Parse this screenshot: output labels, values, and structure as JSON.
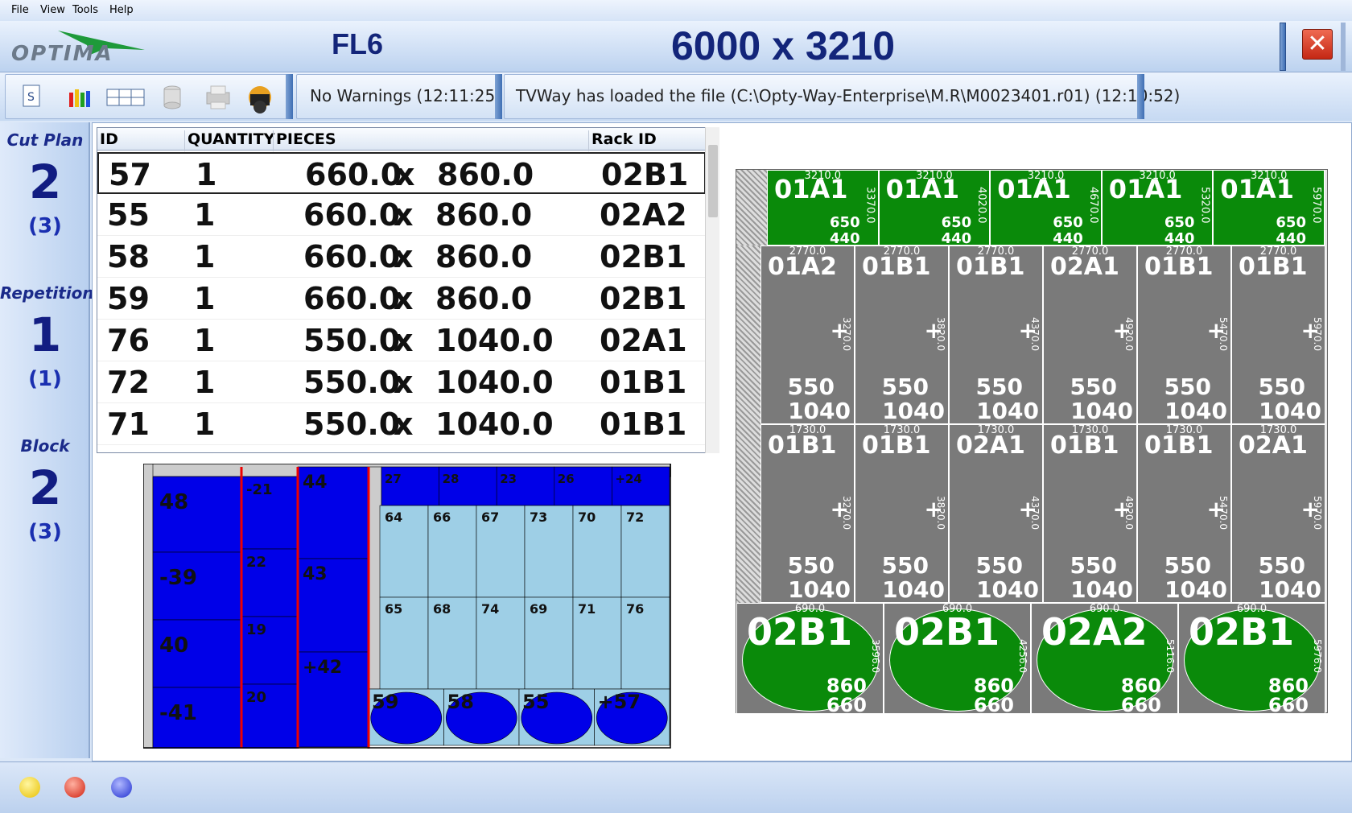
{
  "menu": {
    "file": "File",
    "view": "View",
    "tools": "Tools",
    "help": "Help"
  },
  "header": {
    "logo_text": "OPTIMA",
    "machine": "FL6",
    "dimensions": "6000 x 3210",
    "close": "✕"
  },
  "toolbar": {
    "warnings": "No Warnings (12:11:25)",
    "status": "TVWay has loaded the file (C:\\Opty-Way-Enterprise\\M.R\\M0023401.r01) (12:10:52)"
  },
  "left_panel": {
    "cut_plan_label": "Cut Plan",
    "cut_plan_value": "2",
    "cut_plan_total": "(3)",
    "repetition_label": "Repetition",
    "repetition_value": "1",
    "repetition_total": "(1)",
    "block_label": "Block",
    "block_value": "2",
    "block_total": "(3)"
  },
  "table": {
    "headers": {
      "id": "ID",
      "quantity": "QUANTITY",
      "pieces": "PIECES",
      "rack": "Rack ID"
    },
    "rows": [
      {
        "id": "57",
        "qty": "1",
        "w": "660.0",
        "x": "x",
        "h": "860.0",
        "rack": "02B1"
      },
      {
        "id": "55",
        "qty": "1",
        "w": "660.0",
        "x": "x",
        "h": "860.0",
        "rack": "02A2"
      },
      {
        "id": "58",
        "qty": "1",
        "w": "660.0",
        "x": "x",
        "h": "860.0",
        "rack": "02B1"
      },
      {
        "id": "59",
        "qty": "1",
        "w": "660.0",
        "x": "x",
        "h": "860.0",
        "rack": "02B1"
      },
      {
        "id": "76",
        "qty": "1",
        "w": "550.0",
        "x": "x",
        "h": "1040.0",
        "rack": "02A1"
      },
      {
        "id": "72",
        "qty": "1",
        "w": "550.0",
        "x": "x",
        "h": "1040.0",
        "rack": "01B1"
      },
      {
        "id": "71",
        "qty": "1",
        "w": "550.0",
        "x": "x",
        "h": "1040.0",
        "rack": "01B1"
      }
    ]
  },
  "map": {
    "col1": [
      "48",
      "-39",
      "40",
      "-41"
    ],
    "col2": [
      "-21",
      "22",
      "19",
      "20"
    ],
    "col3": [
      "44",
      "43",
      "+42"
    ],
    "top_strip": [
      "27",
      "28",
      "23",
      "26",
      "+24"
    ],
    "grid_row1": [
      "64",
      "66",
      "67",
      "73",
      "70",
      "72"
    ],
    "grid_row2": [
      "65",
      "68",
      "74",
      "69",
      "71",
      "76"
    ],
    "ovals": [
      "59",
      "58",
      "55",
      "+57"
    ]
  },
  "sheet": {
    "green_top": [
      {
        "rack": "01A1",
        "top": "3210.0",
        "side": "3370.0",
        "w": "650",
        "h": "440"
      },
      {
        "rack": "01A1",
        "top": "3210.0",
        "side": "4020.0",
        "w": "650",
        "h": "440"
      },
      {
        "rack": "01A1",
        "top": "3210.0",
        "side": "4670.0",
        "w": "650",
        "h": "440"
      },
      {
        "rack": "01A1",
        "top": "3210.0",
        "side": "5320.0",
        "w": "650",
        "h": "440"
      },
      {
        "rack": "01A1",
        "top": "3210.0",
        "side": "5970.0",
        "w": "650",
        "h": "440"
      }
    ],
    "gray_row1": [
      {
        "rack": "01A2",
        "top": "2770.0",
        "side": "3270.0",
        "w": "550",
        "h": "1040"
      },
      {
        "rack": "01B1",
        "top": "2770.0",
        "side": "3820.0",
        "w": "550",
        "h": "1040"
      },
      {
        "rack": "01B1",
        "top": "2770.0",
        "side": "4370.0",
        "w": "550",
        "h": "1040"
      },
      {
        "rack": "02A1",
        "top": "2770.0",
        "side": "4920.0",
        "w": "550",
        "h": "1040"
      },
      {
        "rack": "01B1",
        "top": "2770.0",
        "side": "5470.0",
        "w": "550",
        "h": "1040"
      },
      {
        "rack": "01B1",
        "top": "2770.0",
        "side": "5970.0",
        "w": "550",
        "h": "1040"
      }
    ],
    "gray_row2": [
      {
        "rack": "01B1",
        "top": "1730.0",
        "side": "3270.0",
        "w": "550",
        "h": "1040"
      },
      {
        "rack": "01B1",
        "top": "1730.0",
        "side": "3820.0",
        "w": "550",
        "h": "1040"
      },
      {
        "rack": "02A1",
        "top": "1730.0",
        "side": "4370.0",
        "w": "550",
        "h": "1040"
      },
      {
        "rack": "01B1",
        "top": "1730.0",
        "side": "4920.0",
        "w": "550",
        "h": "1040"
      },
      {
        "rack": "01B1",
        "top": "1730.0",
        "side": "5470.0",
        "w": "550",
        "h": "1040"
      },
      {
        "rack": "02A1",
        "top": "1730.0",
        "side": "5970.0",
        "w": "550",
        "h": "1040"
      }
    ],
    "ovals": [
      {
        "rack": "02B1",
        "top": "690.0",
        "side": "3596.0",
        "w": "860",
        "h": "660"
      },
      {
        "rack": "02B1",
        "top": "690.0",
        "side": "4256.0",
        "w": "860",
        "h": "660"
      },
      {
        "rack": "02A2",
        "top": "690.0",
        "side": "5116.0",
        "w": "860",
        "h": "660"
      },
      {
        "rack": "02B1",
        "top": "690.0",
        "side": "5976.0",
        "w": "860",
        "h": "660"
      }
    ]
  },
  "colors": {
    "green": "#0a8a0a",
    "gray": "#7a7a7a",
    "blue": "#0000e8",
    "lightblue": "#9ecfe6",
    "navy": "#13257a"
  }
}
